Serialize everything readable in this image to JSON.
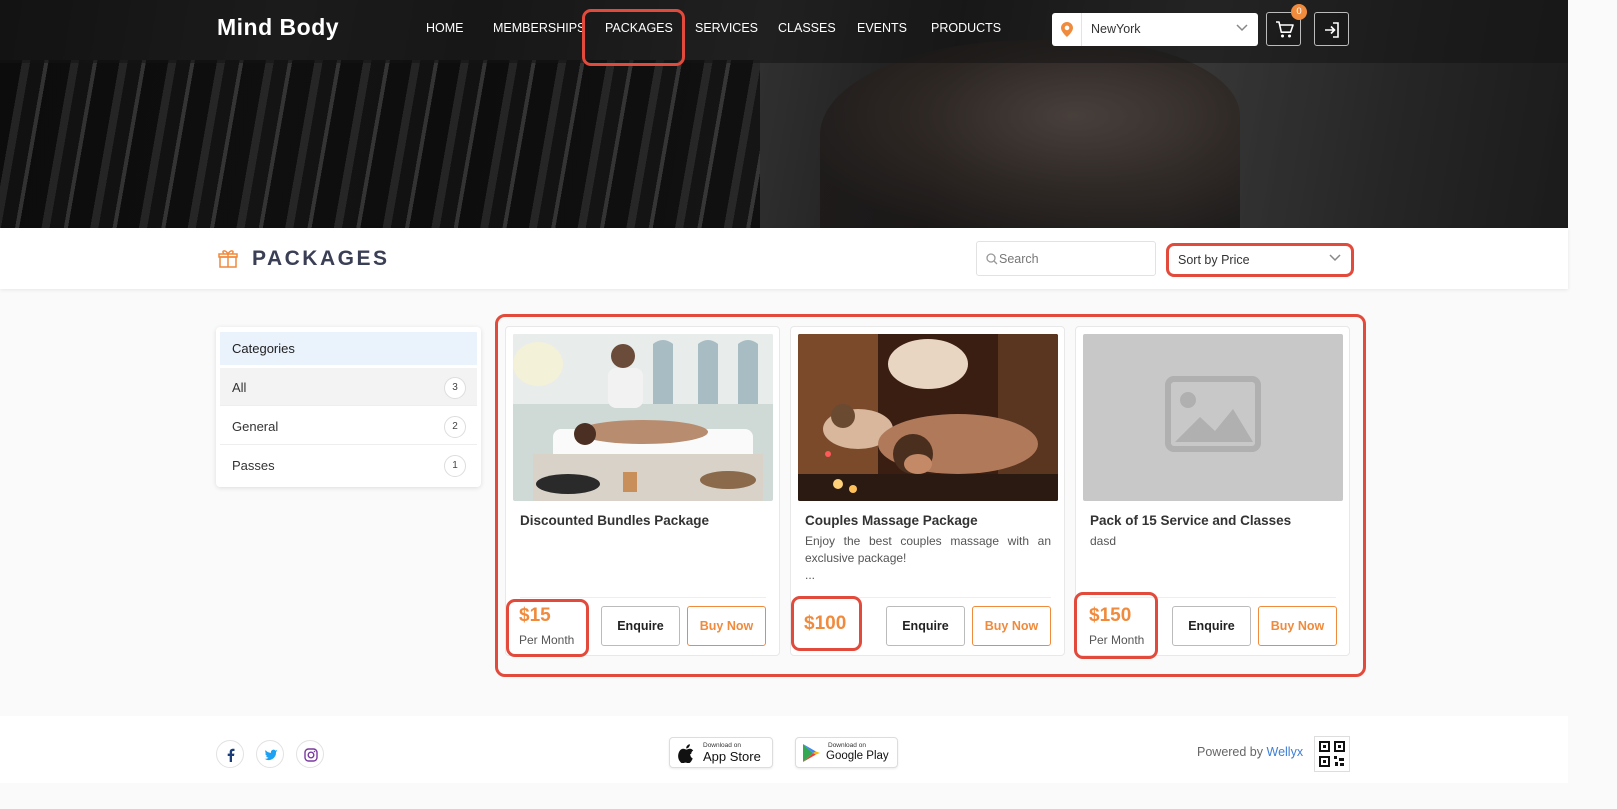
{
  "header": {
    "brand": "Mind Body",
    "nav": [
      "HOME",
      "MEMBERSHIPS",
      "PACKAGES",
      "SERVICES",
      "CLASSES",
      "EVENTS",
      "PRODUCTS"
    ],
    "active_nav": "PACKAGES",
    "location": "NewYork",
    "cart_count": "0"
  },
  "page": {
    "title": "PACKAGES",
    "search_placeholder": "Search",
    "sort_value": "Sort by Price"
  },
  "categories": {
    "heading": "Categories",
    "items": [
      {
        "label": "All",
        "count": "3"
      },
      {
        "label": "General",
        "count": "2"
      },
      {
        "label": "Passes",
        "count": "1"
      }
    ]
  },
  "packages": [
    {
      "name": "Discounted Bundles Package",
      "description": "",
      "more": "",
      "price": "$15",
      "period": "Per Month",
      "enquire": "Enquire",
      "buy": "Buy Now"
    },
    {
      "name": "Couples Massage Package",
      "description": "Enjoy the best couples massage with an exclusive package!",
      "more": "...",
      "price": "$100",
      "period": "",
      "enquire": "Enquire",
      "buy": "Buy Now"
    },
    {
      "name": "Pack of 15 Service and Classes",
      "description": "dasd",
      "more": "",
      "price": "$150",
      "period": "Per Month",
      "enquire": "Enquire",
      "buy": "Buy Now"
    }
  ],
  "footer": {
    "appstore_small": "Download on",
    "appstore_big": "App Store",
    "googleplay_small": "Download on",
    "googleplay_big": "Google Play",
    "powered_prefix": "Powered by",
    "powered_link": "Wellyx"
  },
  "colors": {
    "accent": "#f08a3c",
    "highlight": "#e24a3b",
    "title": "#3a3f55"
  }
}
